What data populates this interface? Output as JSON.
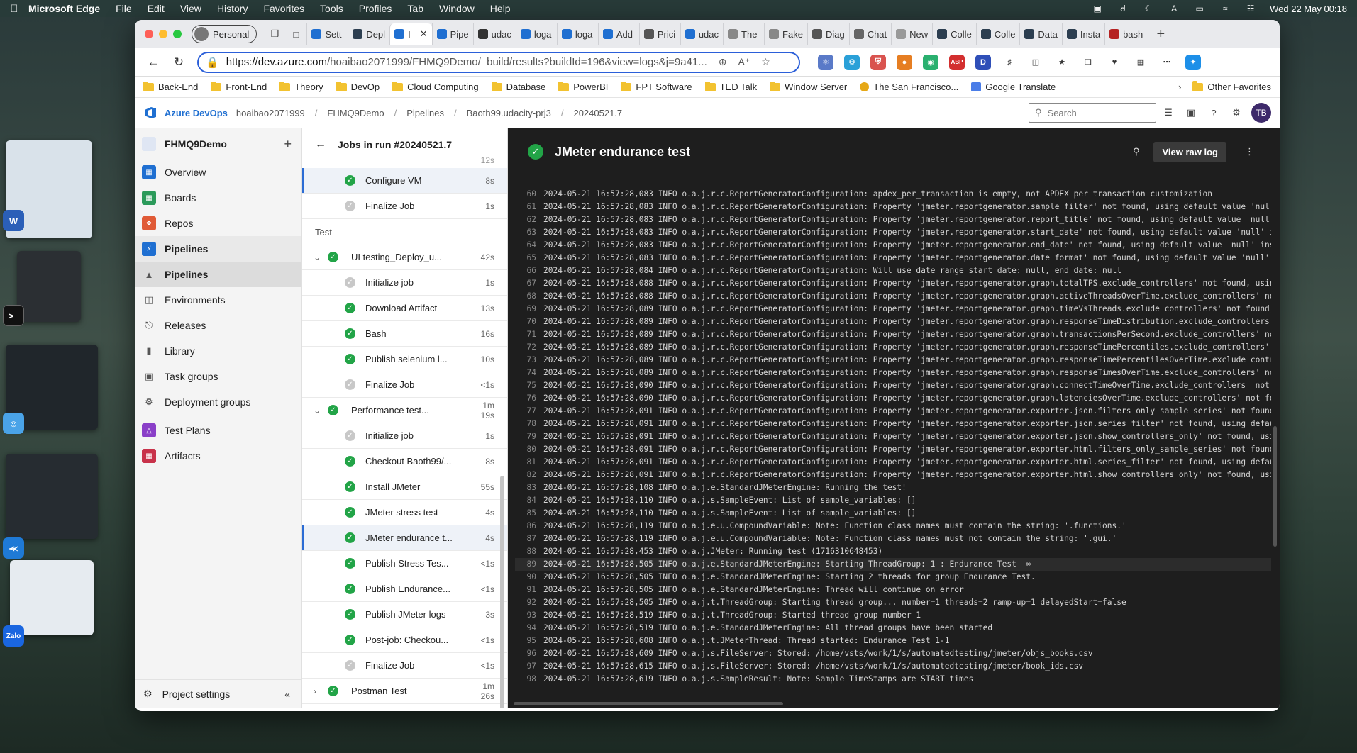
{
  "menubar": {
    "app": "Microsoft Edge",
    "items": [
      "File",
      "Edit",
      "View",
      "History",
      "Favorites",
      "Tools",
      "Profiles",
      "Tab",
      "Window",
      "Help"
    ],
    "clock": "Wed 22 May  00:18"
  },
  "browser": {
    "profile": "Personal",
    "tabs": [
      "Sett",
      "Depl",
      "I",
      "Pipe",
      "udac",
      "loga",
      "loga",
      "Add",
      "Prici",
      "udac",
      "The",
      "Fake",
      "Diag",
      "Chat",
      "New",
      "Colle",
      "Colle",
      "Data",
      "Insta",
      "bash"
    ],
    "url_host": "https://dev.azure.com",
    "url_path": "/hoaibao2071999/FHMQ9Demo/_build/results?buildId=196&view=logs&j=9a41...",
    "favorites": [
      "Back-End",
      "Front-End",
      "Theory",
      "DevOp",
      "Cloud Computing",
      "Database",
      "PowerBI",
      "FPT Software",
      "TED Talk",
      "Window Server",
      "The San Francisco...",
      "Google Translate"
    ],
    "other_favorites": "Other Favorites",
    "extensions": [
      "ABP",
      "D"
    ]
  },
  "azure": {
    "brand": "Azure DevOps",
    "breadcrumb": [
      "hoaibao2071999",
      "FHMQ9Demo",
      "Pipelines",
      "Baoth99.udacity-prj3",
      "20240521.7"
    ],
    "search_placeholder": "Search",
    "avatar": "TB",
    "project": "FHMQ9Demo",
    "nav": [
      "Overview",
      "Boards",
      "Repos",
      "Pipelines",
      "Pipelines",
      "Environments",
      "Releases",
      "Library",
      "Task groups",
      "Deployment groups",
      "Test Plans",
      "Artifacts"
    ],
    "project_settings": "Project settings"
  },
  "jobs": {
    "title": "Jobs in run #20240521.7",
    "top_partial_dur": "12s",
    "rows": [
      {
        "label": "Configure VM",
        "dur": "8s",
        "status": "ok"
      },
      {
        "label": "Finalize Job",
        "dur": "1s",
        "status": "skip"
      }
    ],
    "section": "Test",
    "groups": [
      {
        "label": "UI testing_Deploy_u...",
        "dur": "42s",
        "steps": [
          {
            "label": "Initialize job",
            "dur": "1s",
            "status": "skip"
          },
          {
            "label": "Download Artifact",
            "dur": "13s",
            "status": "ok"
          },
          {
            "label": "Bash",
            "dur": "16s",
            "status": "ok"
          },
          {
            "label": "Publish selenium l...",
            "dur": "10s",
            "status": "ok"
          },
          {
            "label": "Finalize Job",
            "dur": "<1s",
            "status": "skip"
          }
        ]
      },
      {
        "label": "Performance test...",
        "dur": "1m 19s",
        "steps": [
          {
            "label": "Initialize job",
            "dur": "1s",
            "status": "skip"
          },
          {
            "label": "Checkout Baoth99/...",
            "dur": "8s",
            "status": "ok"
          },
          {
            "label": "Install JMeter",
            "dur": "55s",
            "status": "ok"
          },
          {
            "label": "JMeter stress test",
            "dur": "4s",
            "status": "ok"
          },
          {
            "label": "JMeter endurance t...",
            "dur": "4s",
            "status": "ok"
          },
          {
            "label": "Publish Stress Tes...",
            "dur": "<1s",
            "status": "ok"
          },
          {
            "label": "Publish Endurance...",
            "dur": "<1s",
            "status": "ok"
          },
          {
            "label": "Publish JMeter logs",
            "dur": "3s",
            "status": "ok"
          },
          {
            "label": "Post-job: Checkou...",
            "dur": "<1s",
            "status": "ok"
          },
          {
            "label": "Finalize Job",
            "dur": "<1s",
            "status": "skip"
          }
        ]
      },
      {
        "label": "Postman Test",
        "dur": "1m 26s",
        "steps": []
      }
    ]
  },
  "log": {
    "title": "JMeter endurance test",
    "raw_button": "View raw log",
    "lines": [
      {
        "n": "60",
        "t": "2024-05-21 16:57:28,083 INFO o.a.j.r.c.ReportGeneratorConfiguration: apdex_per_transaction is empty, not APDEX per transaction customization"
      },
      {
        "n": "61",
        "t": "2024-05-21 16:57:28,083 INFO o.a.j.r.c.ReportGeneratorConfiguration: Property 'jmeter.reportgenerator.sample_filter' not found, using default value 'null' in"
      },
      {
        "n": "62",
        "t": "2024-05-21 16:57:28,083 INFO o.a.j.r.c.ReportGeneratorConfiguration: Property 'jmeter.reportgenerator.report_title' not found, using default value 'null' ins"
      },
      {
        "n": "63",
        "t": "2024-05-21 16:57:28,083 INFO o.a.j.r.c.ReportGeneratorConfiguration: Property 'jmeter.reportgenerator.start_date' not found, using default value 'null' inst"
      },
      {
        "n": "64",
        "t": "2024-05-21 16:57:28,083 INFO o.a.j.r.c.ReportGeneratorConfiguration: Property 'jmeter.reportgenerator.end_date' not found, using default value 'null' instead"
      },
      {
        "n": "65",
        "t": "2024-05-21 16:57:28,083 INFO o.a.j.r.c.ReportGeneratorConfiguration: Property 'jmeter.reportgenerator.date_format' not found, using default value 'null' inst"
      },
      {
        "n": "66",
        "t": "2024-05-21 16:57:28,084 INFO o.a.j.r.c.ReportGeneratorConfiguration: Will use date range start date: null, end date: null"
      },
      {
        "n": "67",
        "t": "2024-05-21 16:57:28,088 INFO o.a.j.r.c.ReportGeneratorConfiguration: Property 'jmeter.reportgenerator.graph.totalTPS.exclude_controllers' not found, using de"
      },
      {
        "n": "68",
        "t": "2024-05-21 16:57:28,088 INFO o.a.j.r.c.ReportGeneratorConfiguration: Property 'jmeter.reportgenerator.graph.activeThreadsOverTime.exclude_controllers' not fo"
      },
      {
        "n": "69",
        "t": "2024-05-21 16:57:28,089 INFO o.a.j.r.c.ReportGeneratorConfiguration: Property 'jmeter.reportgenerator.graph.timeVsThreads.exclude_controllers' not found, us"
      },
      {
        "n": "70",
        "t": "2024-05-21 16:57:28,089 INFO o.a.j.r.c.ReportGeneratorConfiguration: Property 'jmeter.reportgenerator.graph.responseTimeDistribution.exclude_controllers' not"
      },
      {
        "n": "71",
        "t": "2024-05-21 16:57:28,089 INFO o.a.j.r.c.ReportGeneratorConfiguration: Property 'jmeter.reportgenerator.graph.transactionsPerSecond.exclude_controllers' not fo"
      },
      {
        "n": "72",
        "t": "2024-05-21 16:57:28,089 INFO o.a.j.r.c.ReportGeneratorConfiguration: Property 'jmeter.reportgenerator.graph.responseTimePercentiles.exclude_controllers' not"
      },
      {
        "n": "73",
        "t": "2024-05-21 16:57:28,089 INFO o.a.j.r.c.ReportGeneratorConfiguration: Property 'jmeter.reportgenerator.graph.responseTimePercentilesOverTime.exclude_controlle"
      },
      {
        "n": "74",
        "t": "2024-05-21 16:57:28,089 INFO o.a.j.r.c.ReportGeneratorConfiguration: Property 'jmeter.reportgenerator.graph.responseTimesOverTime.exclude_controllers' not fo"
      },
      {
        "n": "75",
        "t": "2024-05-21 16:57:28,090 INFO o.a.j.r.c.ReportGeneratorConfiguration: Property 'jmeter.reportgenerator.graph.connectTimeOverTime.exclude_controllers' not foun"
      },
      {
        "n": "76",
        "t": "2024-05-21 16:57:28,090 INFO o.a.j.r.c.ReportGeneratorConfiguration: Property 'jmeter.reportgenerator.graph.latenciesOverTime.exclude_controllers' not found,"
      },
      {
        "n": "77",
        "t": "2024-05-21 16:57:28,091 INFO o.a.j.r.c.ReportGeneratorConfiguration: Property 'jmeter.reportgenerator.exporter.json.filters_only_sample_series' not found, us"
      },
      {
        "n": "78",
        "t": "2024-05-21 16:57:28,091 INFO o.a.j.r.c.ReportGeneratorConfiguration: Property 'jmeter.reportgenerator.exporter.json.series_filter' not found, using default v"
      },
      {
        "n": "79",
        "t": "2024-05-21 16:57:28,091 INFO o.a.j.r.c.ReportGeneratorConfiguration: Property 'jmeter.reportgenerator.exporter.json.show_controllers_only' not found, using"
      },
      {
        "n": "80",
        "t": "2024-05-21 16:57:28,091 INFO o.a.j.r.c.ReportGeneratorConfiguration: Property 'jmeter.reportgenerator.exporter.html.filters_only_sample_series' not found, us"
      },
      {
        "n": "81",
        "t": "2024-05-21 16:57:28,091 INFO o.a.j.r.c.ReportGeneratorConfiguration: Property 'jmeter.reportgenerator.exporter.html.series_filter' not found, using default v"
      },
      {
        "n": "82",
        "t": "2024-05-21 16:57:28,091 INFO o.a.j.r.c.ReportGeneratorConfiguration: Property 'jmeter.reportgenerator.exporter.html.show_controllers_only' not found, using d"
      },
      {
        "n": "83",
        "t": "2024-05-21 16:57:28,108 INFO o.a.j.e.StandardJMeterEngine: Running the test!"
      },
      {
        "n": "84",
        "t": "2024-05-21 16:57:28,110 INFO o.a.j.s.SampleEvent: List of sample_variables: []"
      },
      {
        "n": "85",
        "t": "2024-05-21 16:57:28,110 INFO o.a.j.s.SampleEvent: List of sample_variables: []"
      },
      {
        "n": "86",
        "t": "2024-05-21 16:57:28,119 INFO o.a.j.e.u.CompoundVariable: Note: Function class names must contain the string: '.functions.'"
      },
      {
        "n": "87",
        "t": "2024-05-21 16:57:28,119 INFO o.a.j.e.u.CompoundVariable: Note: Function class names must not contain the string: '.gui.'"
      },
      {
        "n": "88",
        "t": "2024-05-21 16:57:28,453 INFO o.a.j.JMeter: Running test (1716310648453)"
      },
      {
        "n": "89",
        "t": "2024-05-21 16:57:28,505 INFO o.a.j.e.StandardJMeterEngine: Starting ThreadGroup: 1 : Endurance Test  ∞",
        "hl": true
      },
      {
        "n": "90",
        "t": "2024-05-21 16:57:28,505 INFO o.a.j.e.StandardJMeterEngine: Starting 2 threads for group Endurance Test."
      },
      {
        "n": "91",
        "t": "2024-05-21 16:57:28,505 INFO o.a.j.e.StandardJMeterEngine: Thread will continue on error"
      },
      {
        "n": "92",
        "t": "2024-05-21 16:57:28,505 INFO o.a.j.t.ThreadGroup: Starting thread group... number=1 threads=2 ramp-up=1 delayedStart=false"
      },
      {
        "n": "93",
        "t": "2024-05-21 16:57:28,519 INFO o.a.j.t.ThreadGroup: Started thread group number 1"
      },
      {
        "n": "94",
        "t": "2024-05-21 16:57:28,519 INFO o.a.j.e.StandardJMeterEngine: All thread groups have been started"
      },
      {
        "n": "95",
        "t": "2024-05-21 16:57:28,608 INFO o.a.j.t.JMeterThread: Thread started: Endurance Test 1-1"
      },
      {
        "n": "96",
        "t": "2024-05-21 16:57:28,609 INFO o.a.j.s.FileServer: Stored: /home/vsts/work/1/s/automatedtesting/jmeter/objs_books.csv"
      },
      {
        "n": "97",
        "t": "2024-05-21 16:57:28,615 INFO o.a.j.s.FileServer: Stored: /home/vsts/work/1/s/automatedtesting/jmeter/book_ids.csv"
      },
      {
        "n": "98",
        "t": "2024-05-21 16:57:28,619 INFO o.a.j.s.SampleResult: Note: Sample TimeStamps are START times"
      }
    ]
  }
}
